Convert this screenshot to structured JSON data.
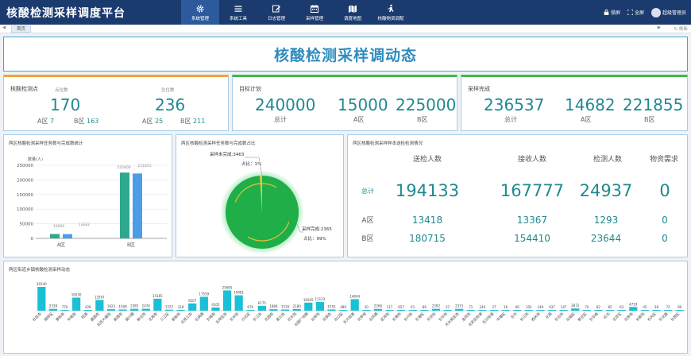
{
  "app": {
    "title": "核酸检测采样调度平台"
  },
  "nav": [
    {
      "label": "系统管理",
      "icon": "gear-icon"
    },
    {
      "label": "系统工具",
      "icon": "menu-icon"
    },
    {
      "label": "日志管理",
      "icon": "edit-icon"
    },
    {
      "label": "采样管理",
      "icon": "calendar-icon"
    },
    {
      "label": "调度地图",
      "icon": "map-icon"
    },
    {
      "label": "核酸物资调配",
      "icon": "person-walk-icon"
    }
  ],
  "header_right": {
    "lock": "锁屏",
    "fullscreen": "全屏",
    "user": "超级管理员"
  },
  "tabs": {
    "home": "首页",
    "refresh": "刷新"
  },
  "page_title": "核酸检测采样调动态",
  "sites": {
    "title": "核酸检测点",
    "col1_label": "点位数",
    "col1_total": "170",
    "col1_a_label": "A区",
    "col1_a": "7",
    "col1_b_label": "B区",
    "col1_b": "163",
    "col2_label": "位位数",
    "col2_total": "236",
    "col2_a_label": "A区",
    "col2_a": "25",
    "col2_b_label": "B区",
    "col2_b": "211"
  },
  "targets": {
    "title": "目标计划",
    "total": "240000",
    "total_label": "总计",
    "a": "15000",
    "a_label": "A区",
    "b": "225000",
    "b_label": "B区"
  },
  "done": {
    "title": "采样完成",
    "total": "236537",
    "total_label": "总计",
    "a": "14682",
    "a_label": "A区",
    "b": "221855",
    "b_label": "B区"
  },
  "task_panel": {
    "title": "两区核酸检测采样任务数与完成数统计",
    "unit": "数量(人)",
    "labels_a": "15000",
    "labels_a2": "14682",
    "labels_b": "225000",
    "labels_b2": "221855"
  },
  "pie_panel": {
    "title": "两区核酸检测采样任务数与完成数占比",
    "unfinished": "采样未完成:3463",
    "unfinished_pct": "占比：1%",
    "finished": "采样完成:2365",
    "finished_pct": "占比：99%"
  },
  "status_panel": {
    "title": "两区核酸检测采样样本送检检测情况",
    "headers": [
      "送检人数",
      "接收人数",
      "检测人数",
      "物资需求"
    ],
    "rows": [
      {
        "label": "总计",
        "values": [
          "194133",
          "167777",
          "24937",
          "0"
        ]
      },
      {
        "label": "A区",
        "values": [
          "13418",
          "13367",
          "1293",
          "0"
        ]
      },
      {
        "label": "B区",
        "values": [
          "180715",
          "154410",
          "23644",
          "0"
        ]
      }
    ]
  },
  "street_panel": {
    "title": "两区街道乡镇核酸检测采样动态"
  },
  "chart_data": [
    {
      "type": "bar",
      "categories": [
        "A区",
        "B区"
      ],
      "series": [
        {
          "values": [
            15000,
            225000
          ],
          "color": "#2ea88f"
        },
        {
          "values": [
            14682,
            221855
          ],
          "color": "#4a9ee8"
        }
      ],
      "ylabel": "数量(人)",
      "yticks": [
        0,
        50000,
        100000,
        150000,
        200000,
        250000
      ],
      "ylim": [
        0,
        250000
      ]
    },
    {
      "type": "pie",
      "slices": [
        {
          "label": "采样完成",
          "value": 99
        },
        {
          "label": "采样未完成",
          "value": 1
        }
      ]
    },
    {
      "type": "bar",
      "color": "#19c0d6",
      "categories": [
        "社区街",
        "瑞祥区",
        "景和街",
        "中南街",
        "旺道",
        "建昌街",
        "社区大厦街",
        "新西街",
        "振兴路",
        "新北街",
        "北苑街",
        "三江区",
        "崭新街",
        "北苑工街",
        "石溪路",
        "东城街",
        "北岸区街",
        "东关街",
        "沙北区",
        "东江街",
        "北园街",
        "星兰街",
        "红东街",
        "北园广场路",
        "北岸街",
        "北辰街",
        "北口区",
        "东方街道",
        "北岸城",
        "北凤路",
        "区湾街",
        "长港街",
        "长兴街",
        "东港区",
        "天京街",
        "东华街",
        "天长新区街",
        "金凤街",
        "北安区街道",
        "石沙街道",
        "中港区",
        "东华",
        "长江街",
        "西关街",
        "北苑",
        "东北街",
        "北城区",
        "新北区",
        "东华南",
        "红北",
        "北京区",
        "北岸街",
        "长新街",
        "长风区",
        "东北路",
        "长西区"
      ],
      "values": [
        30140,
        2338,
        779,
        16530,
        428,
        13597,
        1923,
        1508,
        2385,
        2474,
        15165,
        1322,
        318,
        9207,
        17559,
        4105,
        25685,
        19481,
        676,
        6175,
        1886,
        1516,
        2180,
        10205,
        11123,
        1555,
        489,
        14604,
        20,
        2266,
        117,
        657,
        61,
        86,
        2392,
        37,
        2315,
        71,
        249,
        37,
        36,
        69,
        102,
        149,
        937,
        147,
        2872,
        70,
        82,
        85,
        63,
        4719,
        45,
        38,
        72,
        90
      ]
    }
  ]
}
